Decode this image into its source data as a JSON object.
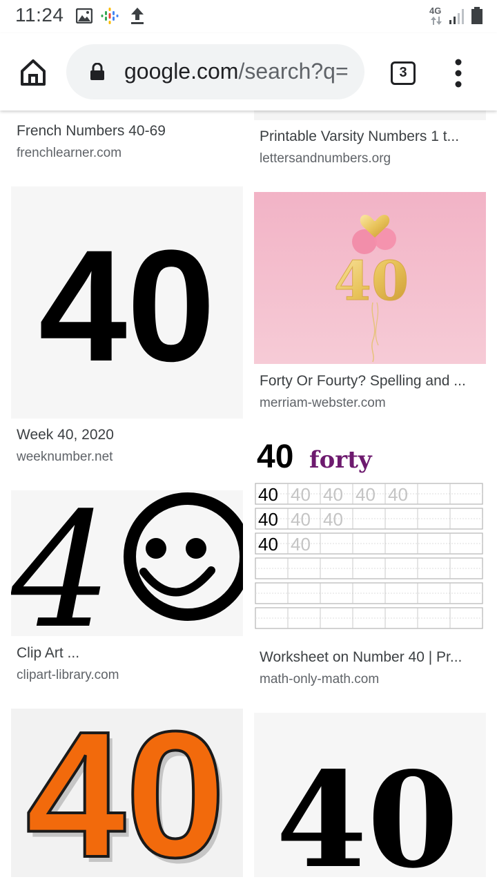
{
  "status_bar": {
    "time": "11:24",
    "network": "4G",
    "icons": [
      "image-icon",
      "google-podcasts-icon",
      "upload-icon",
      "signal-icon",
      "battery-icon"
    ]
  },
  "toolbar": {
    "url_host": "google.com",
    "url_path": "/search?q=",
    "tab_count": "3",
    "icons": [
      "home-icon",
      "lock-icon",
      "more-vert-icon"
    ]
  },
  "results": [
    {
      "title": "French Numbers 40-69",
      "source": "frenchlearner.com"
    },
    {
      "title": "Printable Varsity Numbers 1 t...",
      "source": "lettersandnumbers.org"
    },
    {
      "title": "Week 40, 2020",
      "source": "weeknumber.net",
      "image_text": "40"
    },
    {
      "title": "Forty Or Fourty? Spelling and ...",
      "source": "merriam-webster.com",
      "image_text": "40"
    },
    {
      "title": "Clip Art ...",
      "source": "clipart-library.com",
      "image_text": "4"
    },
    {
      "title": "Worksheet on Number 40 | Pr...",
      "source": "math-only-math.com",
      "image_text": "40",
      "image_word": "forty",
      "trace_rows": [
        [
          "40",
          "40",
          "40",
          "40",
          "40"
        ],
        [
          "40",
          "40",
          "40"
        ],
        [
          "40",
          "40"
        ]
      ]
    },
    {
      "image_text": "40"
    },
    {
      "image_text": "40"
    }
  ],
  "colors": {
    "orange_digits": "#f26a0c",
    "pink_background": "#f4bfce",
    "gold_balloon": "#e8c35a",
    "purple_word": "#6d1a6e"
  }
}
